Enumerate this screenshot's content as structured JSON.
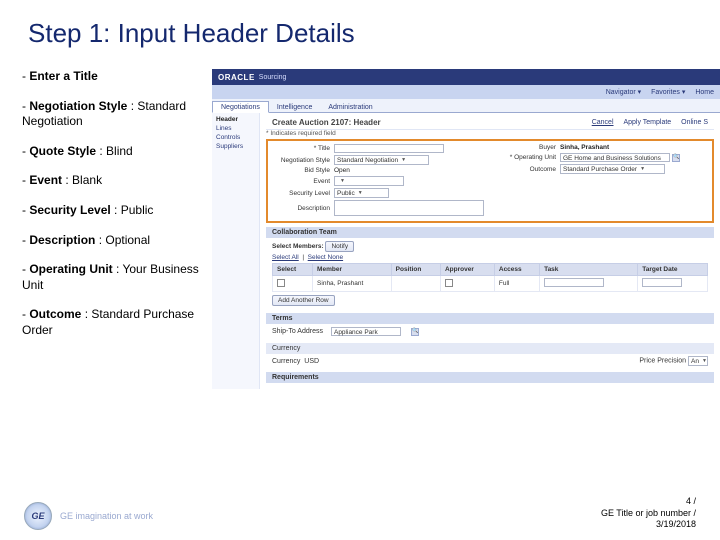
{
  "slide": {
    "title": "Step 1: Input Header Details",
    "bullets": [
      {
        "label": "Enter a Title",
        "value": ""
      },
      {
        "label": "Negotiation Style",
        "value": "Standard Negotiation"
      },
      {
        "label": "Quote Style",
        "value": "Blind"
      },
      {
        "label": "Event",
        "value": "Blank"
      },
      {
        "label": "Security Level",
        "value": "Public"
      },
      {
        "label": "Description",
        "value": "Optional"
      },
      {
        "label": "Operating Unit",
        "value": "Your Business Unit"
      },
      {
        "label": "Outcome",
        "value": "Standard Purchase Order"
      }
    ]
  },
  "app": {
    "brand": "ORACLE",
    "brand_sub": "Sourcing",
    "nav_right": {
      "navigator": "Navigator ▾",
      "favorites": "Favorites ▾",
      "home": "Home"
    },
    "tabs": [
      "Negotiations",
      "Intelligence",
      "Administration"
    ],
    "breadcrumb": "Create Auction 2107: Header",
    "actions": {
      "cancel": "Cancel",
      "apply_template": "Apply Template",
      "save": "Online S"
    },
    "side": {
      "header": "Header",
      "lines": "Lines",
      "controls": "Controls",
      "suppliers": "Suppliers"
    },
    "required_note": "* Indicates required field",
    "form": {
      "title_label": "* Title",
      "neg_style_label": "Negotiation Style",
      "neg_style_value": "Standard Negotiation",
      "bid_style_label": "Bid Style",
      "bid_style_value": "Open",
      "event_label": "Event",
      "security_label": "Security Level",
      "security_value": "Public",
      "description_label": "Description",
      "buyer_label": "Buyer",
      "buyer_value": "Sinha, Prashant",
      "op_unit_label": "* Operating Unit",
      "op_unit_value": "GE Home and Business Solutions",
      "outcome_label": "Outcome",
      "outcome_value": "Standard Purchase Order"
    },
    "collab": {
      "title": "Collaboration Team",
      "select_members": "Select Members:",
      "notify": "Notify",
      "select_all": "Select All",
      "select_none": "Select None",
      "cols": {
        "select": "Select",
        "member": "Member",
        "position": "Position",
        "approver": "Approver",
        "access": "Access",
        "task": "Task",
        "target_date": "Target Date"
      },
      "row_member": "Sinha, Prashant",
      "row_access": "Full",
      "add_row": "Add Another Row"
    },
    "terms": {
      "title": "Terms",
      "shipto_label": "Ship-To Address",
      "shipto_value": "Appliance Park",
      "currency_title": "Currency",
      "currency_label": "Currency",
      "currency_value": "USD",
      "price_precision_label": "Price Precision",
      "price_precision_value": "An"
    },
    "requirements": {
      "title": "Requirements"
    }
  },
  "footer": {
    "ge_mono": "GE",
    "ge_tag": "GE imagination at work",
    "page_num": "4 /",
    "meta_line": "GE Title or job number /",
    "date": "3/19/2018"
  }
}
